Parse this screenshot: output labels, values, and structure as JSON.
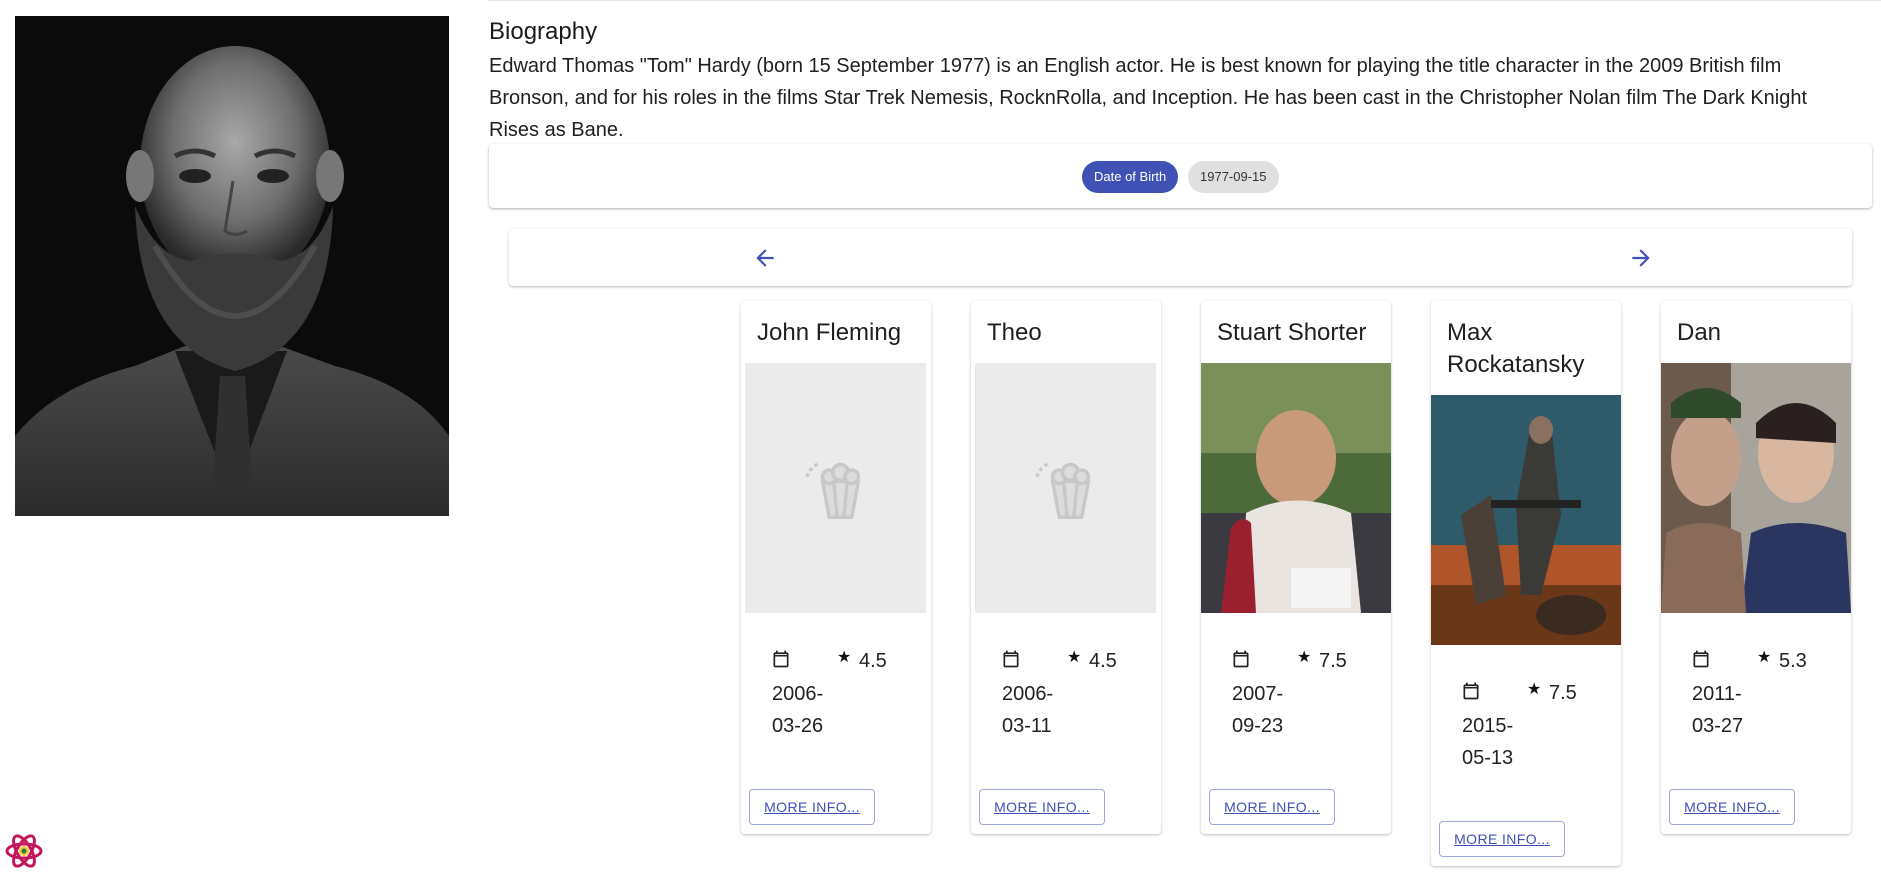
{
  "biography": {
    "title": "Biography",
    "text": "Edward Thomas \"Tom\" Hardy (born 15 September 1977) is an English actor. He is best known for playing the title character in the 2009 British film Bronson, and for his roles in the films Star Trek Nemesis, RocknRolla, and Inception. He has been cast in the Christopher Nolan film The Dark Knight Rises as Bane."
  },
  "details": {
    "dob_label": "Date of Birth",
    "dob_value": "1977-09-15"
  },
  "carousel": {
    "prev_icon": "arrow-left-icon",
    "next_icon": "arrow-right-icon",
    "accent_color": "#3f51b5"
  },
  "movies": [
    {
      "title": "John Fleming",
      "date": "2006-\n03-26",
      "rating": "4.5",
      "image": "popcorn-placeholder",
      "more_label": "MORE INFO..."
    },
    {
      "title": "Theo",
      "date": "2006-\n03-11",
      "rating": "4.5",
      "image": "popcorn-placeholder",
      "more_label": "MORE INFO..."
    },
    {
      "title": "Stuart Shorter",
      "date": "2007-\n09-23",
      "rating": "7.5",
      "image": "poster",
      "more_label": "MORE INFO..."
    },
    {
      "title": "Max Rockatansky",
      "date": "2015-\n05-13",
      "rating": "7.5",
      "image": "poster",
      "more_label": "MORE INFO..."
    },
    {
      "title": "Dan",
      "date": "2011-\n03-27",
      "rating": "5.3",
      "image": "poster",
      "more_label": "MORE INFO..."
    }
  ],
  "devtools": {
    "icon": "react-devtools-icon"
  }
}
